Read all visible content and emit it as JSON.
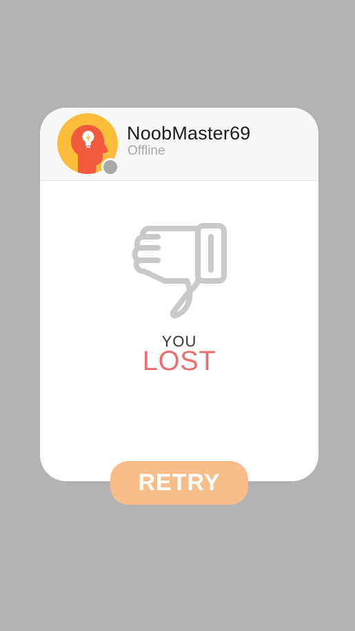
{
  "player": {
    "name": "NoobMaster69",
    "status": "Offline"
  },
  "result": {
    "line1": "YOU",
    "line2": "LOST"
  },
  "actions": {
    "retry_label": "RETRY"
  },
  "icons": {
    "avatar": "head-lightbulb-icon",
    "result": "thumbs-down-icon"
  },
  "colors": {
    "backdrop": "#b3b3b3",
    "avatar_bg": "#fbbd3a",
    "avatar_head": "#f15a3c",
    "status_dot": "#a7a9a8",
    "lost_text": "#ee6e6e",
    "thumb_stroke": "#c9c9cc",
    "retry_button": "#f9bd89"
  }
}
